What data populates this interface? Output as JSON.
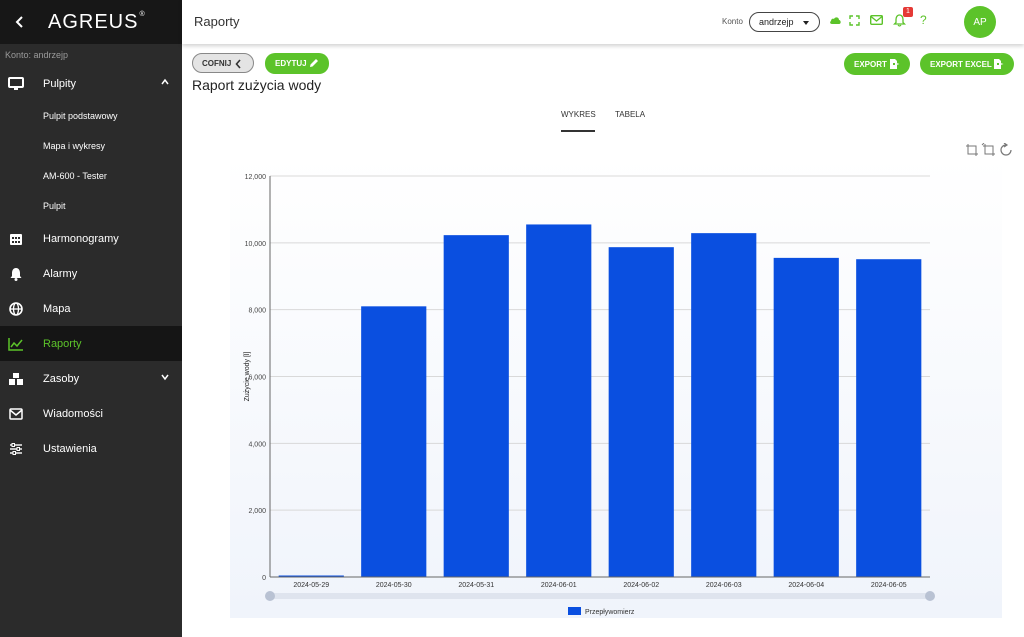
{
  "app": {
    "brand": "AGREUS",
    "brand_mark": "®",
    "account_label": "Konto: andrzejp"
  },
  "sidebar": {
    "items": [
      {
        "label": "Pulpity",
        "icon": "monitor-icon",
        "expanded": true
      },
      {
        "label": "Harmonogramy",
        "icon": "calendar-icon"
      },
      {
        "label": "Alarmy",
        "icon": "bell-icon"
      },
      {
        "label": "Mapa",
        "icon": "globe-icon"
      },
      {
        "label": "Raporty",
        "icon": "chart-line-icon",
        "active": true
      },
      {
        "label": "Zasoby",
        "icon": "boxes-icon",
        "expandable": true
      },
      {
        "label": "Wiadomości",
        "icon": "envelope-icon"
      },
      {
        "label": "Ustawienia",
        "icon": "sliders-icon"
      }
    ],
    "sub_items": [
      "Pulpit podstawowy",
      "Mapa i wykresy",
      "AM-600 - Tester",
      "Pulpit"
    ]
  },
  "topbar": {
    "title": "Raporty",
    "konto_label": "Konto",
    "konto_value": "andrzejp",
    "notification_count": "1",
    "help": "?",
    "avatar_initials": "AP"
  },
  "toolbar": {
    "back_label": "COFNIJ",
    "edit_label": "EDYTUJ",
    "export_label": "EXPORT",
    "export_excel_label": "EXPORT EXCEL"
  },
  "page": {
    "title": "Raport zużycia wody",
    "tabs": [
      "WYKRES",
      "TABELA"
    ],
    "active_tab": "WYKRES"
  },
  "colors": {
    "accent": "#5cc32a",
    "bar": "#0a4fe0",
    "sidebar_bg": "#2b2b2b",
    "badge": "#e53935"
  },
  "chart_data": {
    "type": "bar",
    "categories": [
      "2024-05-29",
      "2024-05-30",
      "2024-05-31",
      "2024-06-01",
      "2024-06-02",
      "2024-06-03",
      "2024-06-04",
      "2024-06-05"
    ],
    "series": [
      {
        "name": "Przepływomierz",
        "values": [
          0,
          8100,
          10230,
          10550,
          9870,
          10290,
          9550,
          9510
        ]
      }
    ],
    "ylabel": "Zużycie wody [l]",
    "yticks": [
      "0",
      "2,000",
      "4,000",
      "6,000",
      "8,000",
      "10,000",
      "12,000"
    ],
    "ylim": [
      0,
      12000
    ],
    "grid": true,
    "legend": "bottom-center"
  }
}
